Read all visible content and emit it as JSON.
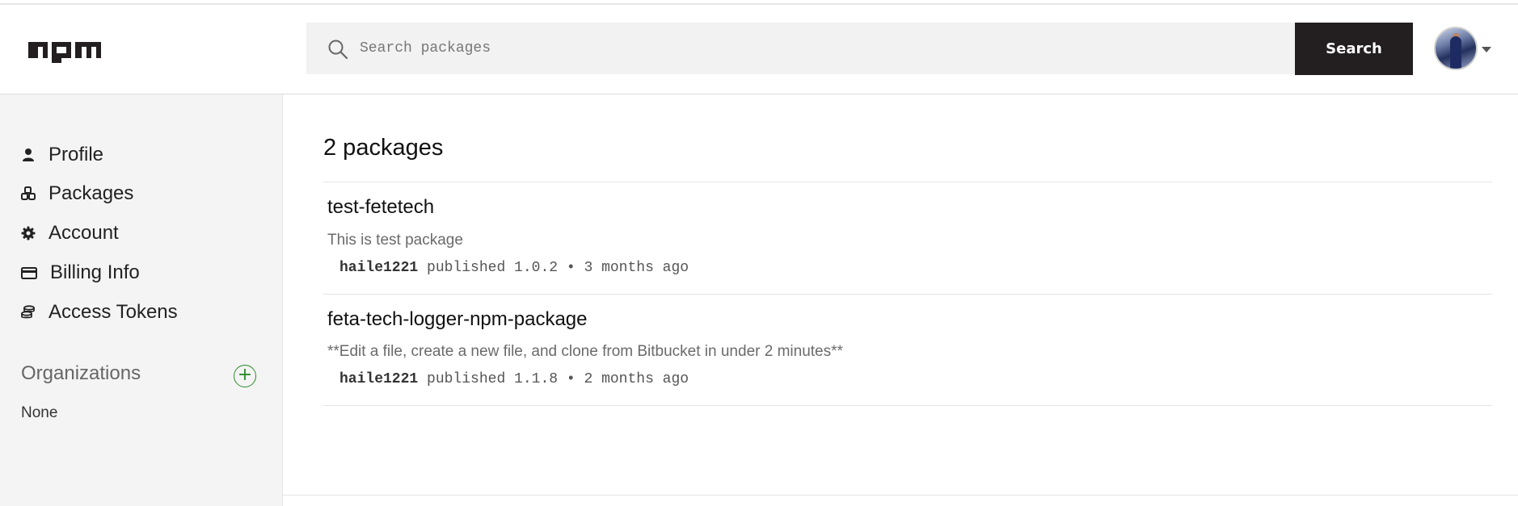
{
  "header": {
    "search": {
      "placeholder": "Search packages",
      "value": ""
    },
    "search_button_label": "Search",
    "colors": {
      "search_button_bg": "#231f20",
      "search_bg": "#f2f2f2"
    }
  },
  "sidebar": {
    "items": [
      {
        "label": "Profile",
        "icon": "user-icon"
      },
      {
        "label": "Packages",
        "icon": "packages-icon"
      },
      {
        "label": "Account",
        "icon": "gear-icon"
      },
      {
        "label": "Billing Info",
        "icon": "credit-card-icon"
      },
      {
        "label": "Access Tokens",
        "icon": "coins-icon"
      }
    ],
    "organizations": {
      "title": "Organizations",
      "add_icon": "plus-circle-icon",
      "empty_text": "None",
      "accent_color": "#2b8a2b"
    }
  },
  "main": {
    "package_count_label": "2 packages",
    "packages": [
      {
        "name": "test-fetetech",
        "description": "This is test package",
        "author": "haile1221",
        "published_text": "published 1.0.2 • 3 months ago"
      },
      {
        "name": "feta-tech-logger-npm-package",
        "description": "**Edit a file, create a new file, and clone from Bitbucket in under 2 minutes**",
        "author": "haile1221",
        "published_text": "published 1.1.8 • 2 months ago"
      }
    ]
  }
}
